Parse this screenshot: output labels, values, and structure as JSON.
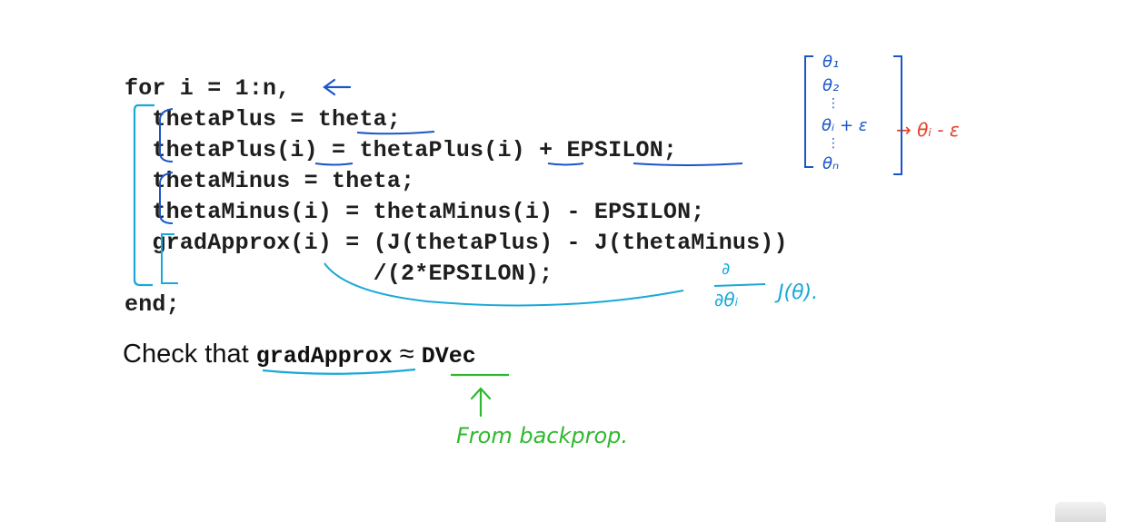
{
  "code": {
    "lines": [
      "for i = 1:n,",
      "  thetaPlus = theta;",
      "  thetaPlus(i) = thetaPlus(i) + EPSILON;",
      "  thetaMinus = theta;",
      "  thetaMinus(i) = thetaMinus(i) - EPSILON;",
      "  gradApprox(i) = (J(thetaPlus) - J(thetaMinus))",
      "                  /(2*EPSILON);",
      "end;"
    ]
  },
  "check": {
    "prefix": "Check that ",
    "grad": "gradApprox",
    "approx": " ≈ ",
    "dvec": "DVec"
  },
  "annotations": {
    "from_backprop": "From backprop.",
    "vector": {
      "theta1": "θ₁",
      "theta2": "θ₂",
      "dots1": "⋮",
      "theta_i_plus": "θᵢ + ε",
      "dots2": "⋮",
      "theta_n": "θₙ",
      "theta_i_minus": "→ θᵢ - ε"
    },
    "derivative": {
      "numerator": "∂",
      "denominator": "∂θᵢ",
      "function": "J(θ)."
    }
  },
  "colors": {
    "text": "#1e1e1e",
    "blue_ink": "#1a56c8",
    "cyan_ink": "#1aa8d8",
    "red_ink": "#e8402a",
    "green_ink": "#2fb82f"
  }
}
